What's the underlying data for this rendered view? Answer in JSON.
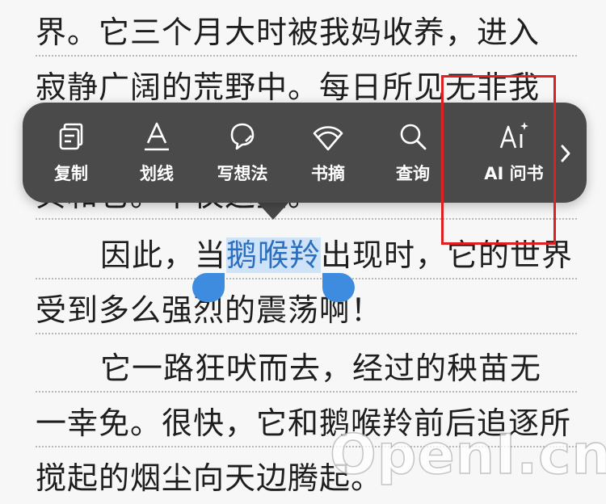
{
  "book_text": {
    "line1": "界。它三个月大时被我妈收养，进入",
    "line2": "寂静广阔的荒野中。每日所见无非我",
    "line3": "贝和它。不仅这些。",
    "line4_before": "因此，当",
    "line4_selected": "鹅喉羚",
    "line4_after": "出现时，它的世界",
    "line5": "受到多么强烈的震荡啊！",
    "line6": "它一路狂吠而去，经过的秧苗无",
    "line7": "一幸免。很快，它和鹅喉羚前后追逐所",
    "line8": "搅起的烟尘向天边腾起。"
  },
  "toolbar": {
    "copy_label": "复制",
    "underline_label": "划线",
    "note_label": "写想法",
    "excerpt_label": "书摘",
    "lookup_label": "查询",
    "ai_label": "AI 问书"
  },
  "watermark": "OpenI.cn",
  "colors": {
    "toolbar_bg": "#4a4a4a",
    "selection_bg": "#cfe3f8",
    "selection_text": "#2b6fc2",
    "handle": "#3d8ce0",
    "highlight_box": "#e02020"
  },
  "icons": [
    "copy-icon",
    "underline-icon",
    "thought-bubble-icon",
    "excerpt-icon",
    "search-icon",
    "ai-sparkle-icon",
    "chevron-right-icon"
  ]
}
